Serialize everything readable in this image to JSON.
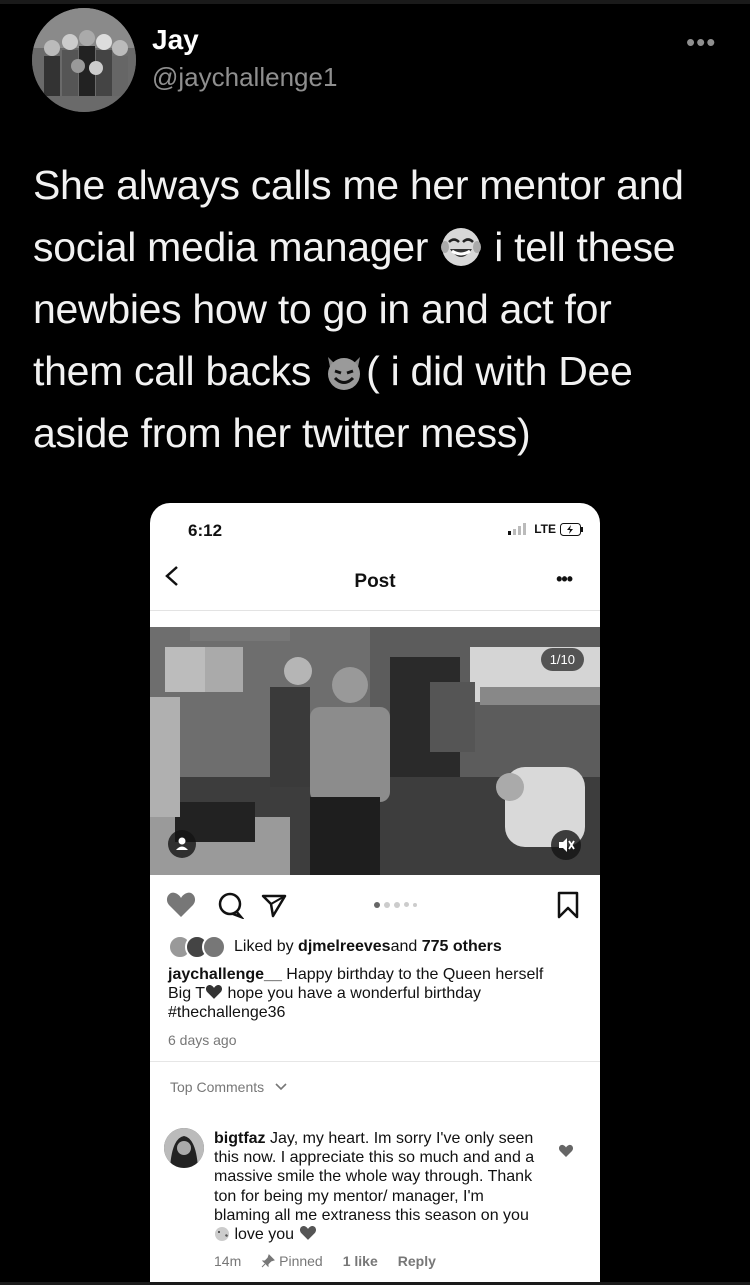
{
  "tweet": {
    "author_name": "Jay",
    "author_handle": "@jaychallenge1",
    "more_label": "•••",
    "lines": [
      "She always calls me her mentor and",
      "social media manager",
      " i tell these",
      "newbies how to go in and act for",
      "them call backs ",
      "( i did with Dee",
      "aside from her twitter mess)"
    ],
    "emojis": [
      "face-with-tears-of-joy-icon",
      "smiling-imp-icon"
    ]
  },
  "screenshot": {
    "status": {
      "time": "6:12",
      "network": "LTE"
    },
    "nav": {
      "title": "Post",
      "more": "•••"
    },
    "media": {
      "counter": "1/10"
    },
    "likes": {
      "prefix": "Liked by ",
      "user": "djmelreeves",
      "middle": " and ",
      "count": "775 others"
    },
    "caption": {
      "user": "jaychallenge__",
      "text1": " Happy birthday to the Queen herself",
      "text2a": "Big T",
      "text2b": " hope you have a wonderful birthday",
      "hashtag": "#thechallenge36"
    },
    "time_ago": "6 days ago",
    "top_comments_label": "Top Comments",
    "comment": {
      "user": "bigtfaz",
      "text": " Jay, my heart. Im sorry I've only seen this now. I appreciate this so much and and a massive smile the whole way through. Thank ton for being my mentor/ manager, I'm blaming all me extraness this season on you",
      "text_end": " love you",
      "time": "14m",
      "pinned": "Pinned",
      "likes": "1 like",
      "reply": "Reply"
    }
  }
}
